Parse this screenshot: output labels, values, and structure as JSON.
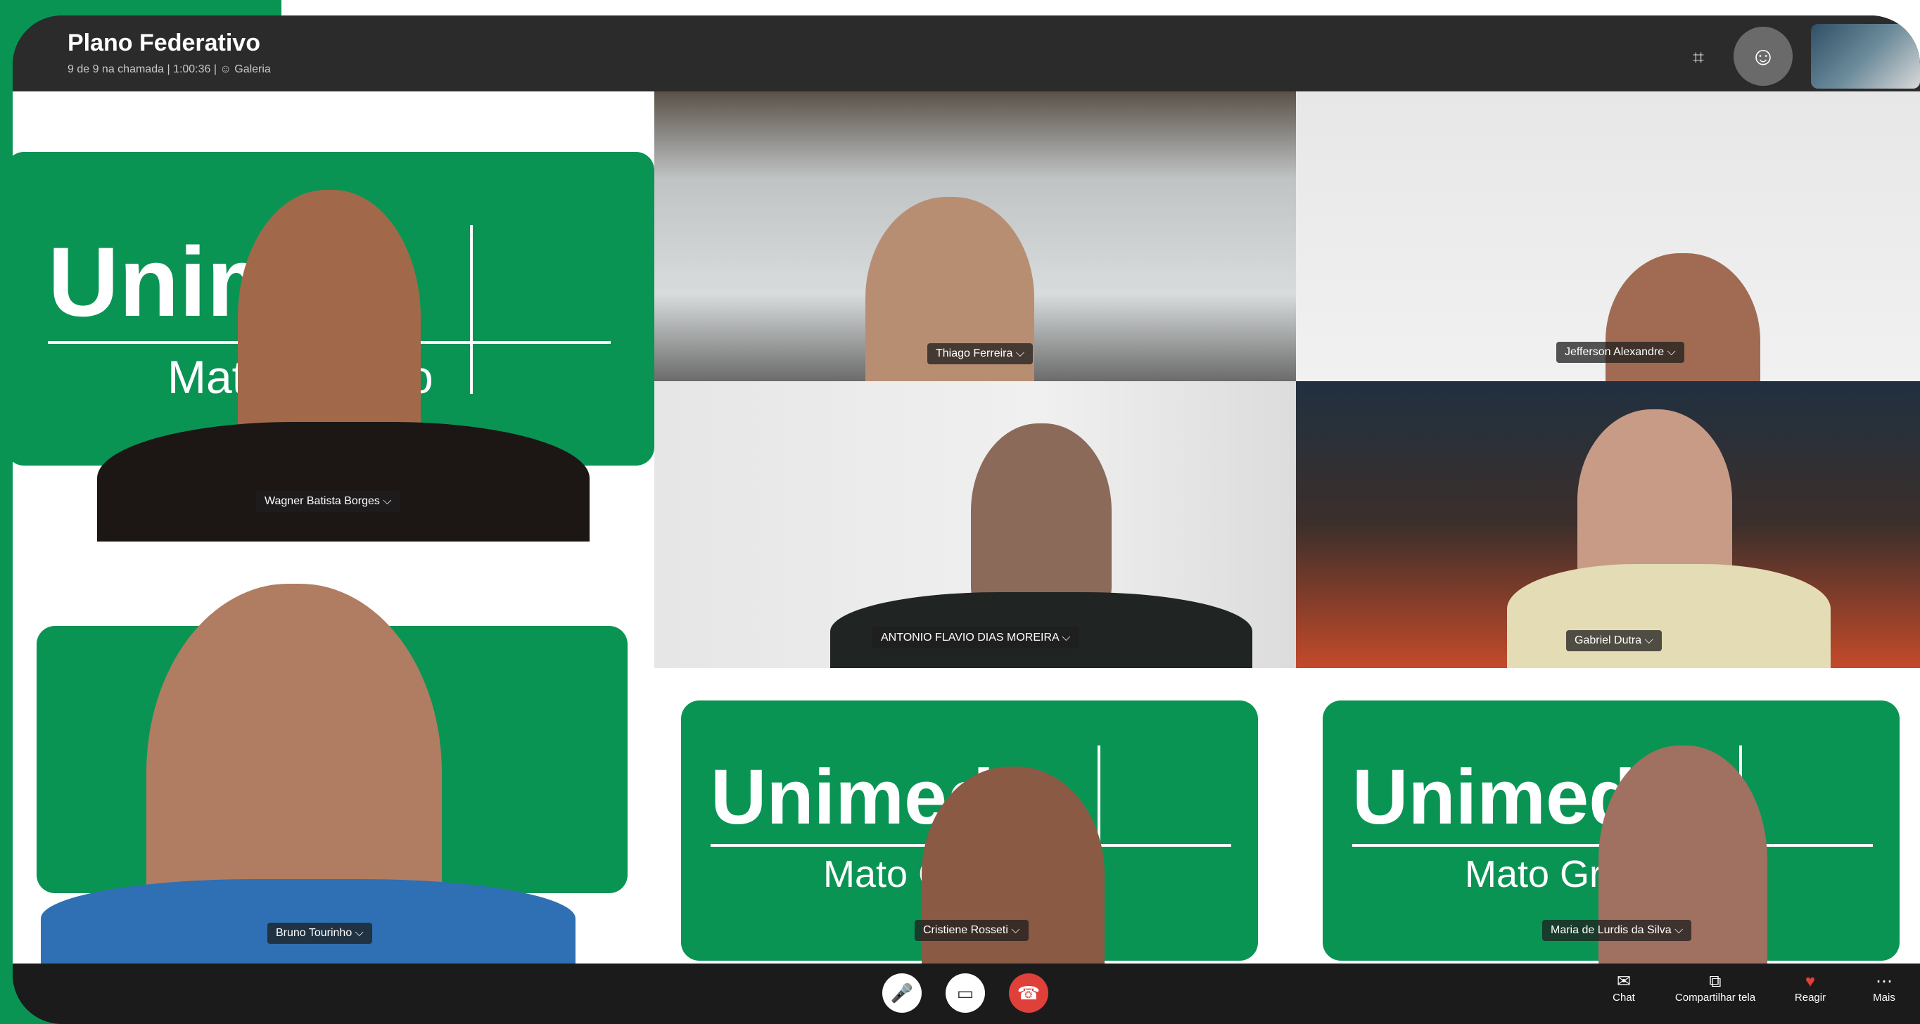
{
  "meeting": {
    "title": "Plano Federativo",
    "subtitle": "9 de 9 na chamada | 1:00:36 | ☺ Galeria"
  },
  "logo": {
    "brand": "Unimed",
    "region": "Mato Grosso",
    "brand_color": "#0a9454"
  },
  "participants": [
    {
      "name": "Wagner Batista Borges ⌵"
    },
    {
      "name": "Thiago Ferreira ⌵"
    },
    {
      "name": "Jefferson Alexandre ⌵"
    },
    {
      "name": "ANTONIO FLAVIO DIAS MOREIRA ⌵"
    },
    {
      "name": "Gabriel Dutra ⌵"
    },
    {
      "name": "Bruno Tourinho ⌵"
    },
    {
      "name": "Cristiene Rosseti ⌵"
    },
    {
      "name": "Maria de Lurdis da Silva ⌵"
    }
  ],
  "toolbar": {
    "chat": "Chat",
    "share": "Compartilhar tela",
    "react": "Reagir",
    "more": "Mais"
  },
  "icons": {
    "layout": "layout-icon",
    "add_people": "add-people-icon",
    "mic": "mic-icon",
    "camera": "camera-icon",
    "hangup": "hangup-icon"
  }
}
